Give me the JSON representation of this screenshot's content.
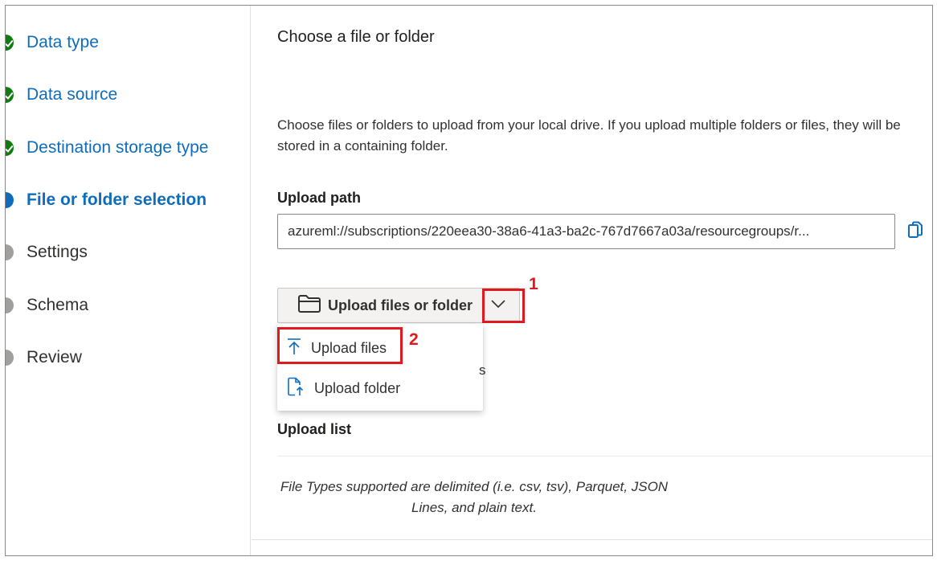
{
  "steps": [
    {
      "label": "Data type",
      "state": "done"
    },
    {
      "label": "Data source",
      "state": "done"
    },
    {
      "label": "Destination storage type",
      "state": "done"
    },
    {
      "label": "File or folder selection",
      "state": "current"
    },
    {
      "label": "Settings",
      "state": "todo"
    },
    {
      "label": "Schema",
      "state": "todo"
    },
    {
      "label": "Review",
      "state": "todo"
    }
  ],
  "main": {
    "title": "Choose a file or folder",
    "description": "Choose files or folders to upload from your local drive. If you upload multiple folders or files, they will be stored in a containing folder.",
    "upload_path_label": "Upload path",
    "upload_path_value": "azureml://subscriptions/220eea30-38a6-41a3-ba2c-767d7667a03a/resourcegroups/r...",
    "upload_button_label": "Upload files or folder",
    "menu": {
      "upload_files": "Upload files",
      "upload_folder": "Upload folder"
    },
    "obscured_text": "s",
    "upload_list_label": "Upload list",
    "file_types_note": "File Types supported are delimited (i.e. csv, tsv), Parquet, JSON Lines, and plain text."
  },
  "annotations": {
    "callout_1": "1",
    "callout_2": "2"
  },
  "colors": {
    "accent": "#0f6cbd",
    "success": "#107c10",
    "annotation": "#e0191e"
  },
  "icons": {
    "copy": "copy-icon",
    "folder": "folder-icon",
    "chevron": "chevron-down-icon",
    "upload_files": "upload-arrow-icon",
    "upload_folder": "folder-upload-icon"
  }
}
